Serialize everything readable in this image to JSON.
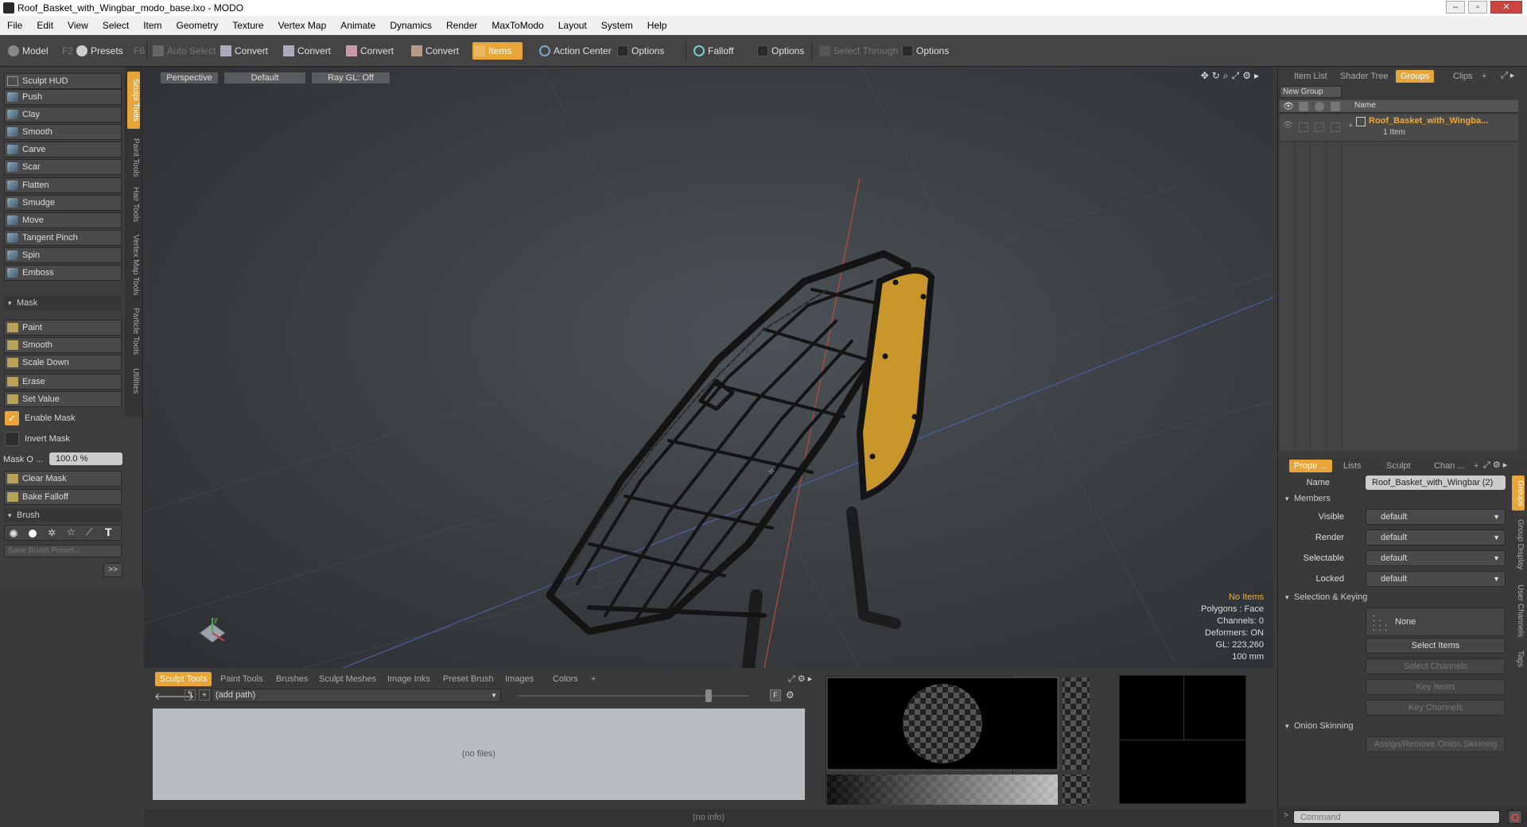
{
  "window": {
    "title": "Roof_Basket_with_Wingbar_modo_base.lxo - MODO"
  },
  "menu": [
    "File",
    "Edit",
    "View",
    "Select",
    "Item",
    "Geometry",
    "Texture",
    "Vertex Map",
    "Animate",
    "Dynamics",
    "Render",
    "MaxToModo",
    "Layout",
    "System",
    "Help"
  ],
  "toolbar": {
    "model": "Model",
    "model_key": "F2",
    "presets": "Presets",
    "presets_key": "F6",
    "auto_select": "Auto Select",
    "convert1": "Convert",
    "convert2": "Convert",
    "convert3": "Convert",
    "convert4": "Convert",
    "items": "Items",
    "action_center": "Action Center",
    "options1": "Options",
    "falloff": "Falloff",
    "options2": "Options",
    "select_through": "Select Through",
    "options3": "Options"
  },
  "left": {
    "sculpt_hud": "Sculpt HUD",
    "tools": [
      "Push",
      "Clay",
      "Smooth",
      "Carve",
      "Scar",
      "Flatten",
      "Smudge",
      "Move",
      "Tangent Pinch",
      "Spin",
      "Emboss"
    ],
    "mask_header": "Mask",
    "mask_tools": [
      "Paint",
      "Smooth",
      "Scale Down"
    ],
    "erase": "Erase",
    "set_value": "Set Value",
    "enable_mask": "Enable Mask",
    "invert_mask": "Invert Mask",
    "mask_opacity_label": "Mask O ...",
    "mask_opacity_value": "100.0 %",
    "clear_mask": "Clear Mask",
    "bake_falloff": "Bake Falloff",
    "brush_header": "Brush",
    "save_brush_preset": "Save Brush Preset...",
    "more": ">>"
  },
  "vtabs": [
    "Sculpt Tools",
    "Paint Tools",
    "Hair Tools",
    "Vertex Map Tools",
    "Particle Tools",
    "Utilities"
  ],
  "viewport": {
    "view": "Perspective",
    "style": "Default",
    "raygl": "Ray GL: Off",
    "info": [
      "No Items",
      "Polygons : Face",
      "Channels: 0",
      "Deformers: ON",
      "GL: 223,260",
      "100 mm"
    ]
  },
  "bottom": {
    "tabs": [
      "Sculpt Tools",
      "Paint Tools",
      "Brushes",
      "Sculpt Meshes",
      "Image Inks",
      "Preset Brush",
      "Images",
      "Colors",
      "+"
    ],
    "path": "(add path)",
    "no_files": "(no files)",
    "f_btn": "F"
  },
  "status": "(no info)",
  "right_top": {
    "tabs": [
      "Item List",
      "Shader Tree",
      "Groups",
      "Clips",
      "+"
    ],
    "new_group": "New Group",
    "col_name": "Name",
    "group_name": "Roof_Basket_with_Wingba...",
    "group_count": "1 Item"
  },
  "right_bottom": {
    "tabs": [
      "Prope ...",
      "Lists",
      "Sculpt",
      "Chan ...",
      "+"
    ],
    "name_label": "Name",
    "name_value": "Roof_Basket_with_Wingbar (2)",
    "members": "Members",
    "rows": [
      {
        "label": "Visible",
        "value": "default"
      },
      {
        "label": "Render",
        "value": "default"
      },
      {
        "label": "Selectable",
        "value": "default"
      },
      {
        "label": "Locked",
        "value": "default"
      }
    ],
    "sel_keying": "Selection & Keying",
    "none": "None",
    "select_items": "Select Items",
    "select_channels": "Select Channels",
    "key_items": "Key Items",
    "key_channels": "Key Channels",
    "onion": "Onion Skinning",
    "assign_onion": "Assign/Remove Onion Skinning",
    "side_tabs": [
      "Groups",
      "Group Display",
      "User Channels",
      "Tags"
    ]
  },
  "command": {
    "placeholder": "Command"
  },
  "colors": {
    "accent": "#e8a53a"
  }
}
